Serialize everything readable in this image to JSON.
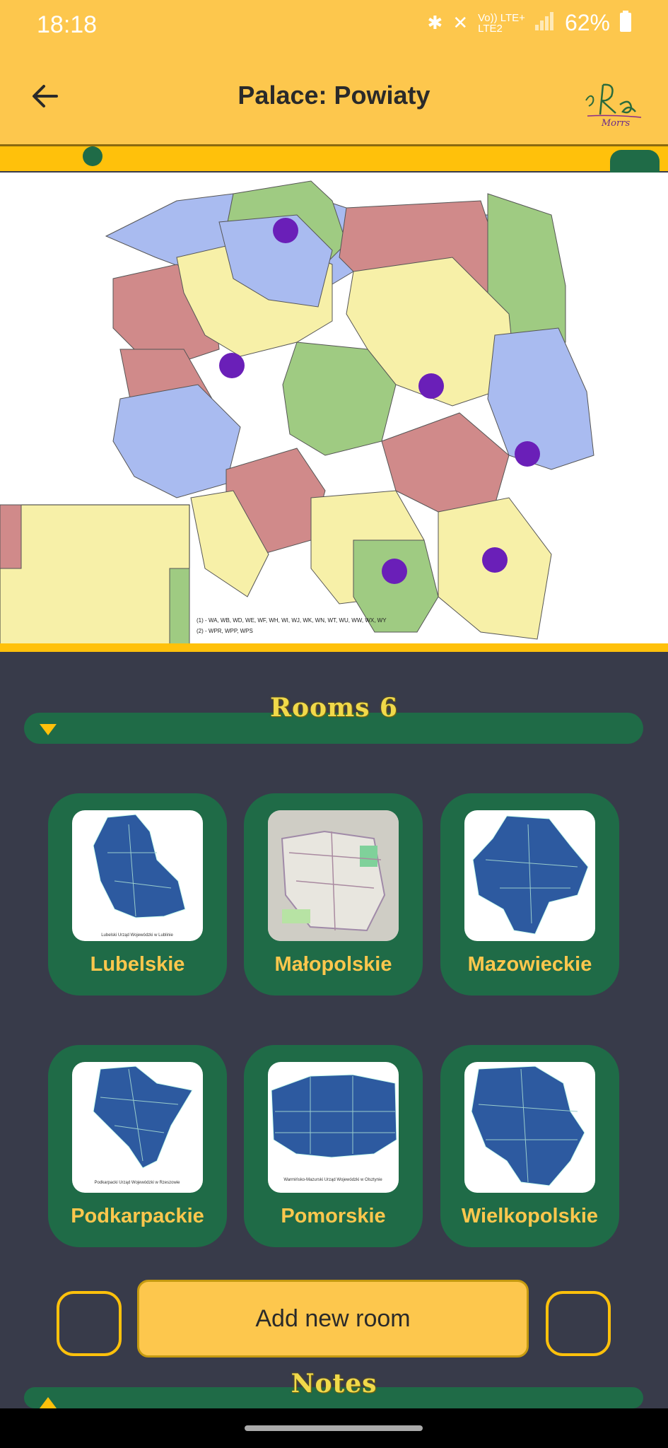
{
  "status_bar": {
    "time": "18:18",
    "network_line1": "Vo)) LTE+",
    "network_line2": "LTE2",
    "battery": "62%"
  },
  "app_bar": {
    "title": "Palace: Powiaty",
    "logo_text": "Morrs"
  },
  "map": {
    "footnote_1": "(1) - WA, WB, WD, WE, WF, WH, WI, WJ, WK, WN, WT, WU, WW, WX, WY",
    "footnote_2": "(2) - WPR, WPP, WPS",
    "marker_color": "#6a1fb8"
  },
  "sections": {
    "rooms_title": "Rooms 6",
    "notes_title": "Notes"
  },
  "rooms": [
    {
      "label": "Lubelskie",
      "thumb_caption": "Lubelski Urząd Wojewódzki w Lublinie"
    },
    {
      "label": "Małopolskie"
    },
    {
      "label": "Mazowieckie"
    },
    {
      "label": "Podkarpackie",
      "thumb_caption": "Podkarpacki Urząd Wojewódzki w Rzeszowie"
    },
    {
      "label": "Pomorskie",
      "thumb_caption": "Warmińsko-Mazurski Urząd Wojewódzki w Olsztynie"
    },
    {
      "label": "Wielkopolskie"
    }
  ],
  "actions": {
    "add_room_label": "Add new room"
  },
  "colors": {
    "accent": "#fdc74d",
    "primary_green": "#1f6b47",
    "background": "#383b4a"
  }
}
